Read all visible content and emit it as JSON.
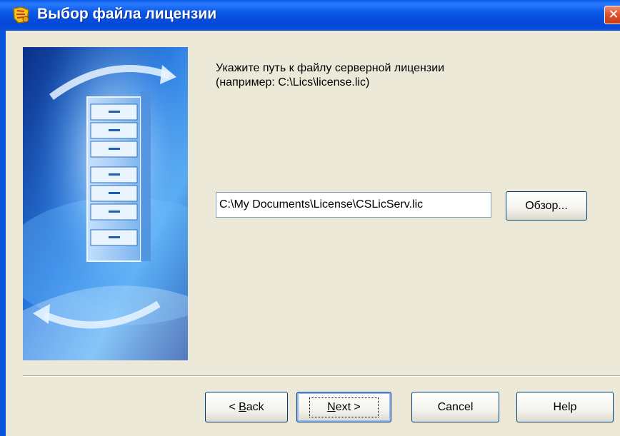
{
  "window": {
    "title": "Выбор файла лицензии",
    "close_glyph": "✕",
    "icons": {
      "app": "license-key-icon",
      "close": "close-icon"
    }
  },
  "wizard": {
    "side_image": "server-cabinet-illustration",
    "instruction_line1": "Укажите путь к файлу серверной лицензии",
    "instruction_line2": "(например: C:\\Lics\\license.lic)",
    "path_value": "C:\\My Documents\\License\\CSLicServ.lic",
    "browse_label": "Обзор..."
  },
  "buttons": {
    "back_prefix": "< ",
    "back_accel": "B",
    "back_rest": "ack",
    "next_accel": "N",
    "next_rest": "ext >",
    "cancel": "Cancel",
    "help": "Help"
  },
  "colors": {
    "titlebar": "#0a55e0",
    "client_bg": "#ece9d8",
    "close_button": "#e0502a"
  }
}
